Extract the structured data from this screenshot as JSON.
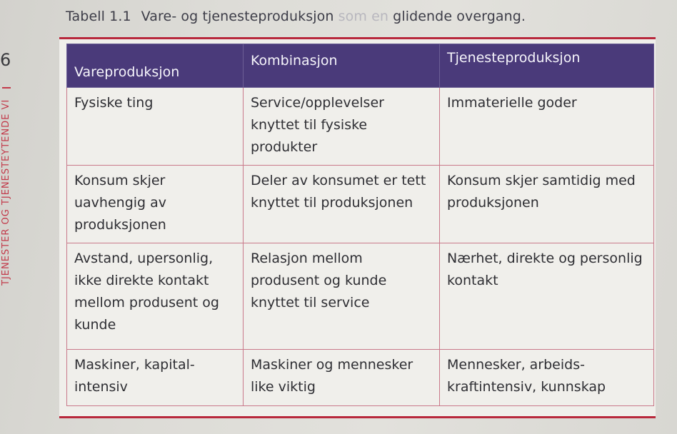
{
  "page_number": "6",
  "running_header": "TJENESTER OG TJENESTEYTENDE VIRKSOMHETER",
  "caption": {
    "label": "Tabell 1.1",
    "text_main": "Vare- og tjenesteproduksjon",
    "text_faded": "som en",
    "text_end": "glidende overgang."
  },
  "table": {
    "headers": [
      "Vareproduksjon",
      "Kombinasjon",
      "Tjenesteproduksjon"
    ],
    "rows": [
      [
        "Fysiske ting",
        "Service/opplevelser knyttet til fysiske produkter",
        "Immaterielle goder"
      ],
      [
        "Konsum skjer uavhengig av produksjonen",
        "Deler av konsumet er tett knyttet til produksjonen",
        "Konsum skjer samtidig med produksjonen"
      ],
      [
        "Avstand, upersonlig, ikke direkte kontakt mellom produsent og kunde",
        "Relasjon mellom produsent og kunde knyttet til service",
        "Nærhet, direkte og personlig kontakt"
      ],
      [
        "Maskiner, kapital- intensiv",
        "Maskiner og mennesker like viktig",
        "Mennesker, arbeids- kraftintensiv, kunnskap"
      ]
    ]
  },
  "colors": {
    "header_bg": "#4a3a7a",
    "accent_red": "#b8283c",
    "grid_line": "#c9798a",
    "paper": "#f0efeb"
  }
}
